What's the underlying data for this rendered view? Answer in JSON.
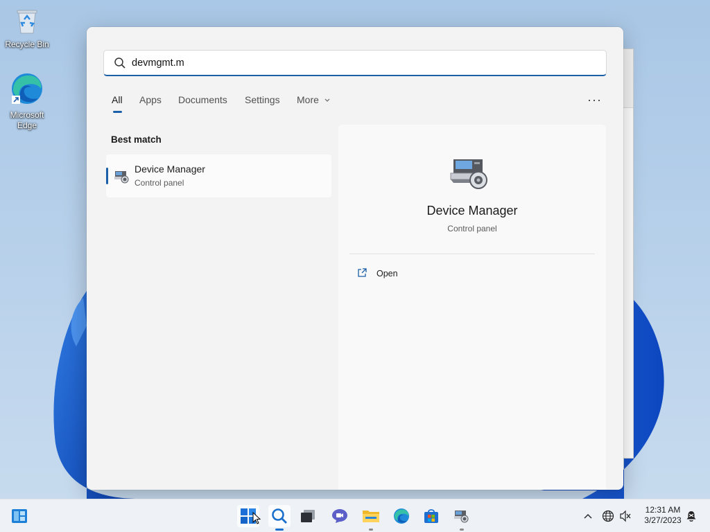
{
  "desktop": {
    "icons": [
      {
        "label": "Recycle Bin",
        "icon": "recycle-bin-icon"
      },
      {
        "label": "Microsoft Edge",
        "icon": "edge-icon"
      }
    ]
  },
  "search": {
    "query": "devmgmt.m",
    "tabs": [
      {
        "label": "All",
        "active": true
      },
      {
        "label": "Apps"
      },
      {
        "label": "Documents"
      },
      {
        "label": "Settings"
      },
      {
        "label": "More"
      }
    ],
    "more_options": "···",
    "best_match_heading": "Best match",
    "result": {
      "title": "Device Manager",
      "subtitle": "Control panel"
    },
    "detail": {
      "title": "Device Manager",
      "subtitle": "Control panel",
      "actions": [
        {
          "label": "Open",
          "icon": "open-external-icon"
        }
      ]
    }
  },
  "taskbar": {
    "apps": [
      "widgets-icon",
      "start-icon",
      "search-icon",
      "task-view-icon",
      "chat-icon",
      "file-explorer-icon",
      "edge-icon",
      "store-icon",
      "device-manager-icon"
    ],
    "clock": {
      "time": "12:31 AM",
      "date": "3/27/2023"
    }
  },
  "colors": {
    "accent": "#1a5fa8",
    "panel_bg": "#f3f3f3"
  }
}
